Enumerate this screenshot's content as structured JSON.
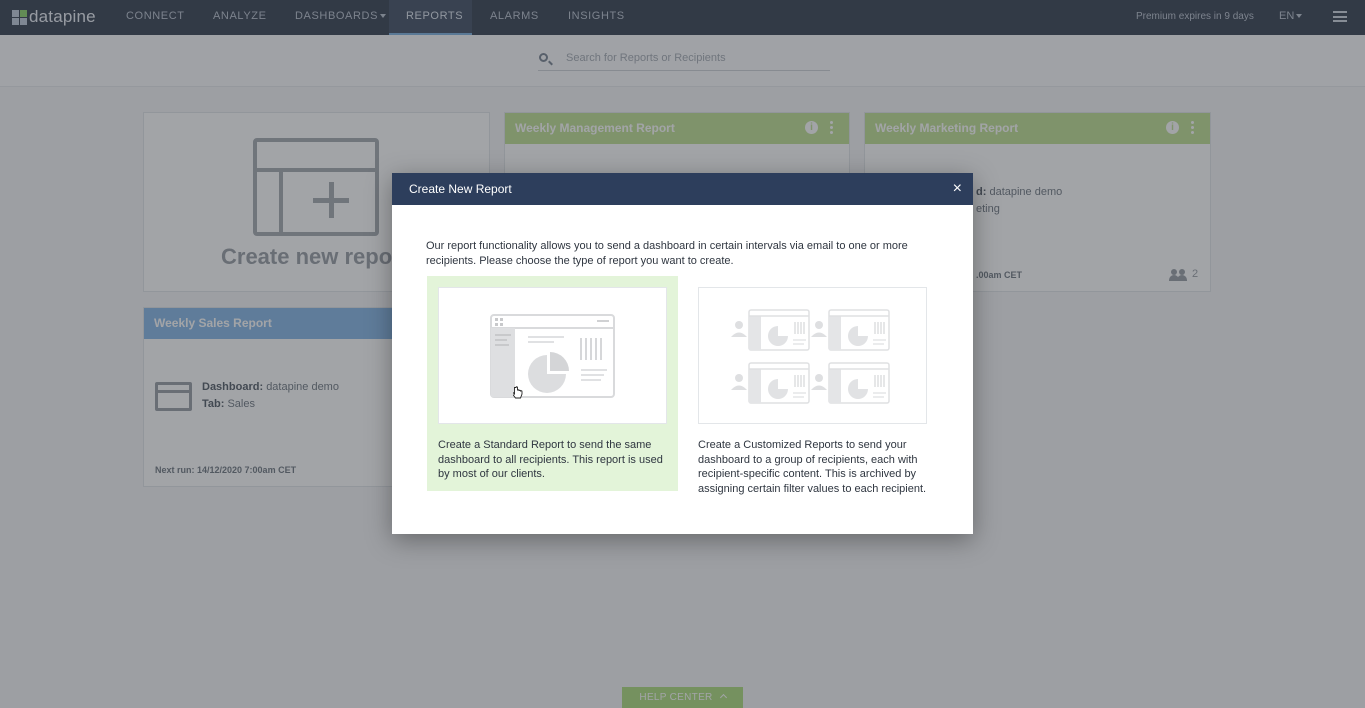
{
  "app": {
    "logo_text": "datapine",
    "brand_color": "#7fcf5a"
  },
  "nav": {
    "items": [
      {
        "label": "CONNECT"
      },
      {
        "label": "ANALYZE"
      },
      {
        "label": "DASHBOARDS"
      },
      {
        "label": "REPORTS",
        "active": true
      },
      {
        "label": "ALARMS"
      },
      {
        "label": "INSIGHTS"
      }
    ],
    "premium": "Premium expires in 9 days",
    "language": "EN"
  },
  "search": {
    "placeholder": "Search for Reports or Recipients"
  },
  "cards": {
    "create": {
      "label": "Create new report"
    },
    "management": {
      "title": "Weekly Management Report"
    },
    "marketing": {
      "title": "Weekly Marketing Report",
      "dashboard_label": "d:",
      "dashboard_value": "datapine demo",
      "tab_value": "eting",
      "next_run": ".00am CET",
      "recipients": "2"
    },
    "sales": {
      "title": "Weekly Sales Report",
      "dashboard_label": "Dashboard:",
      "dashboard_value": "datapine demo",
      "tab_label": "Tab:",
      "tab_value": "Sales",
      "next_run": "Next run: 14/12/2020 7:00am CET"
    }
  },
  "modal": {
    "title": "Create New Report",
    "close": "×",
    "intro": "Our report functionality allows you to send a dashboard in certain intervals via email to one or more recipients. Please choose the type of report you want to create.",
    "options": [
      {
        "name": "standard",
        "selected": true,
        "description": "Create a Standard Report to send the same dashboard to all recipients. This report is used by most of our clients."
      },
      {
        "name": "customized",
        "selected": false,
        "description": "Create a Customized Reports to send your dashboard to a group of recipients, each with recipient-specific content. This is archived by assigning certain filter values to each recipient."
      }
    ]
  },
  "help": {
    "label": "HELP CENTER"
  },
  "colors": {
    "header_green": "#b9dd86",
    "header_blue": "#79aee4",
    "modal_header": "#2d3e5c",
    "selected_bg": "#e3f4d9"
  }
}
